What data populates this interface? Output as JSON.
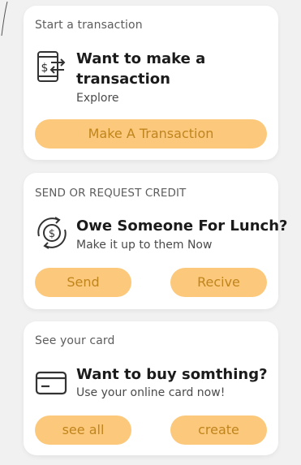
{
  "transaction_card": {
    "section_title": "Start a transaction",
    "icon": "phone-money-transfer-icon",
    "heading": "Want to make a transaction",
    "subtext": "Explore",
    "button_label": "Make A Transaction"
  },
  "credit_card": {
    "section_title": "SEND OR REQUEST CREDIT",
    "icon": "dollar-cycle-icon",
    "heading": "Owe Someone For Lunch?",
    "subtext": "Make it up to them Now",
    "send_label": "Send",
    "receive_label": "Recive"
  },
  "card_card": {
    "section_title": "See your card",
    "icon": "credit-card-icon",
    "heading": "Want to buy somthing?",
    "subtext": "Use your online card now!",
    "see_all_label": "see all",
    "create_label": "create"
  },
  "colors": {
    "background": "#f1f1f1",
    "card": "#ffffff",
    "button_fill": "#fcc97c",
    "button_text": "#c0841d",
    "heading_text": "#1b1b1b"
  }
}
